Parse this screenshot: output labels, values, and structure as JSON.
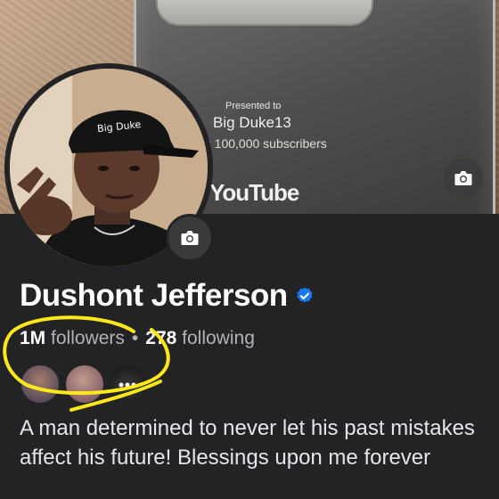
{
  "cover": {
    "plaque_presented": "Presented to",
    "plaque_name": "Big Duke13",
    "plaque_subs": "g 100,000 subscribers",
    "plaque_brand": "YouTube",
    "cap_text": "Big Duke",
    "camera_icon": "camera-icon"
  },
  "profile": {
    "name": "Dushont Jefferson",
    "verified_icon": "verified-badge-icon",
    "verified_color": "#1877f2",
    "followers_count": "1M",
    "followers_label": "followers",
    "separator": "•",
    "following_count": "278",
    "following_label": "following",
    "bio": "A man determined to never let his past mistakes affect his future! Blessings upon me forever"
  },
  "annotation": {
    "color": "#ffe81a"
  }
}
